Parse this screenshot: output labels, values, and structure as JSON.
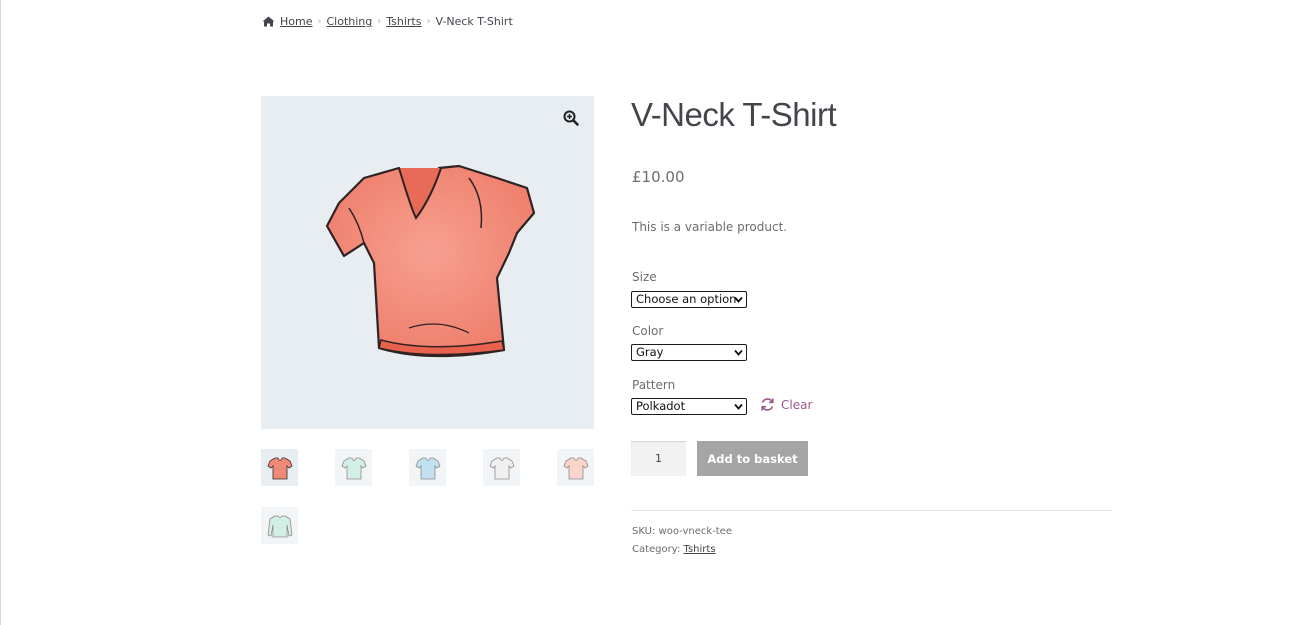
{
  "breadcrumb": {
    "home": "Home",
    "items": [
      "Clothing",
      "Tshirts"
    ],
    "current": "V-Neck T-Shirt"
  },
  "product": {
    "title": "V-Neck T-Shirt",
    "price": "£10.00",
    "description": "This is a variable product.",
    "main_image_color": "#f08a78"
  },
  "variations": [
    {
      "label": "Size",
      "selected": "Choose an option"
    },
    {
      "label": "Color",
      "selected": "Gray"
    },
    {
      "label": "Pattern",
      "selected": "Polkadot"
    }
  ],
  "clear_label": "Clear",
  "quantity": "1",
  "add_to_basket_label": "Add to basket",
  "meta": {
    "sku_label": "SKU:",
    "sku": "woo-vneck-tee",
    "category_label": "Category:",
    "category": "Tshirts"
  },
  "thumbnails": [
    {
      "color": "#f08a78",
      "kind": "tee"
    },
    {
      "color": "#aee3d0",
      "kind": "tee"
    },
    {
      "color": "#8fc9e6",
      "kind": "tee"
    },
    {
      "color": "#e4e4e4",
      "kind": "tee"
    },
    {
      "color": "#f7b3a3",
      "kind": "tee"
    },
    {
      "color": "#aee3d0",
      "kind": "longsleeve"
    }
  ],
  "colors": {
    "accent": "#96588a",
    "button": "#a5a5a5",
    "image_bg": "#e8edf1",
    "text": "#6d6d6d",
    "heading": "#43454b"
  },
  "icons": {
    "home": "home-icon",
    "zoom": "zoom-in-icon",
    "clear": "refresh-icon"
  }
}
